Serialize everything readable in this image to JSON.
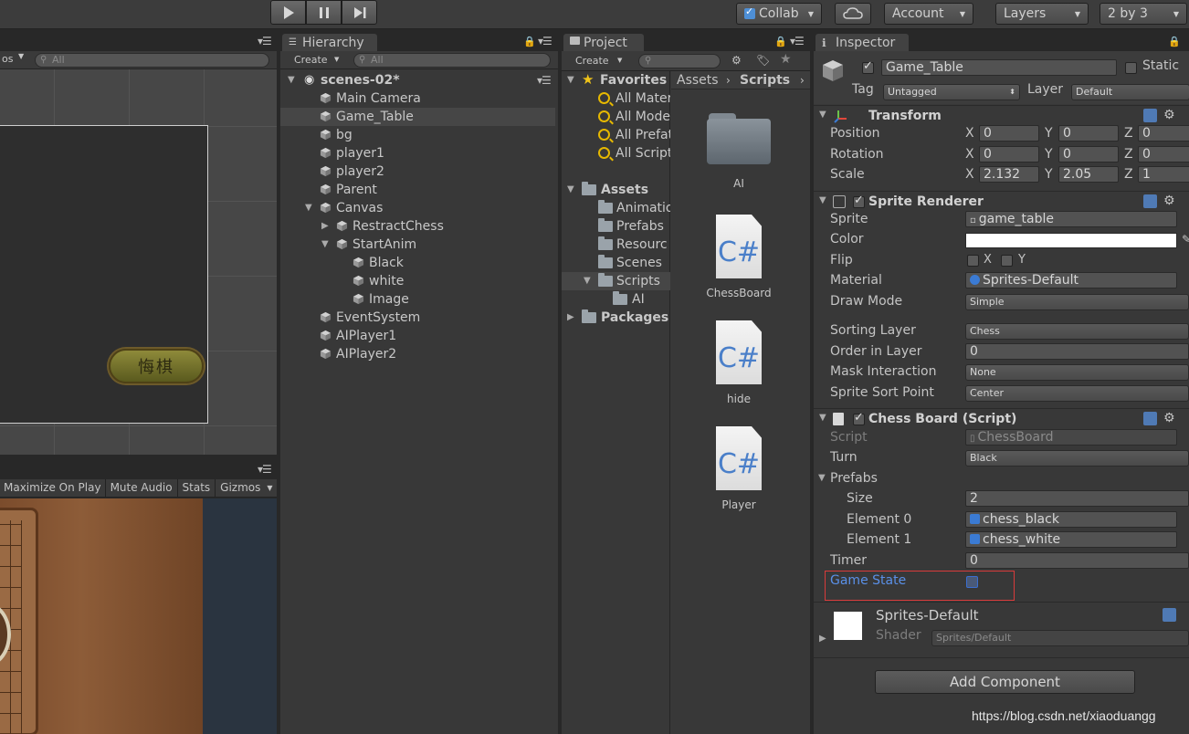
{
  "toolbar": {
    "collab": "Collab",
    "account": "Account",
    "layers": "Layers",
    "layout": "2 by 3"
  },
  "scene": {
    "gizmos_partial": "os",
    "search_placeholder": "All",
    "button_text": "悔棋"
  },
  "game_toolbar": {
    "maximize": "Maximize On Play",
    "mute": "Mute Audio",
    "stats": "Stats",
    "gizmos": "Gizmos"
  },
  "hierarchy": {
    "tab": "Hierarchy",
    "create": "Create",
    "search_placeholder": "All",
    "scene_name": "scenes-02*",
    "items": [
      {
        "label": "Main Camera"
      },
      {
        "label": "Game_Table"
      },
      {
        "label": "bg"
      },
      {
        "label": "player1"
      },
      {
        "label": "player2"
      },
      {
        "label": "Parent"
      },
      {
        "label": "Canvas"
      },
      {
        "label": "RestractChess"
      },
      {
        "label": "StartAnim"
      },
      {
        "label": "Black"
      },
      {
        "label": "white"
      },
      {
        "label": "Image"
      },
      {
        "label": "EventSystem"
      },
      {
        "label": "AIPlayer1"
      },
      {
        "label": "AIPlayer2"
      }
    ]
  },
  "project": {
    "tab": "Project",
    "create": "Create",
    "favorites": "Favorites",
    "fav_items": [
      "All Mater",
      "All Mode",
      "All Prefat",
      "All Script"
    ],
    "assets": "Assets",
    "asset_folders": [
      "Animatio",
      "Prefabs",
      "Resourc",
      "Scenes",
      "Scripts",
      "AI"
    ],
    "packages": "Packages",
    "breadcrumb": [
      "Assets",
      "Scripts"
    ],
    "files": [
      {
        "name": "AI",
        "kind": "folder"
      },
      {
        "name": "ChessBoard",
        "kind": "cs",
        "glyph": "C#"
      },
      {
        "name": "hide",
        "kind": "cs",
        "glyph": "C#"
      },
      {
        "name": "Player",
        "kind": "cs",
        "glyph": "C#"
      }
    ]
  },
  "inspector": {
    "tab": "Inspector",
    "object_name": "Game_Table",
    "static": "Static",
    "tag_label": "Tag",
    "tag_value": "Untagged",
    "layer_label": "Layer",
    "layer_value": "Default",
    "transform": {
      "title": "Transform",
      "position_label": "Position",
      "rotation_label": "Rotation",
      "scale_label": "Scale",
      "axis_x": "X",
      "axis_y": "Y",
      "axis_z": "Z",
      "position": [
        "0",
        "0",
        "0"
      ],
      "rotation": [
        "0",
        "0",
        "0"
      ],
      "scale": [
        "2.132",
        "2.05",
        "1"
      ]
    },
    "sprite_renderer": {
      "title": "Sprite Renderer",
      "sprite_label": "Sprite",
      "sprite_value": "game_table",
      "color_label": "Color",
      "color_value": "#ffffff",
      "flip_label": "Flip",
      "flip_x": "X",
      "flip_y": "Y",
      "material_label": "Material",
      "material_value": "Sprites-Default",
      "draw_mode_label": "Draw Mode",
      "draw_mode_value": "Simple",
      "sorting_layer_label": "Sorting Layer",
      "sorting_layer_value": "Chess",
      "order_label": "Order in Layer",
      "order_value": "0",
      "mask_label": "Mask Interaction",
      "mask_value": "None",
      "sort_point_label": "Sprite Sort Point",
      "sort_point_value": "Center"
    },
    "chess_board": {
      "title": "Chess Board (Script)",
      "script_label": "Script",
      "script_value": "ChessBoard",
      "turn_label": "Turn",
      "turn_value": "Black",
      "prefabs_label": "Prefabs",
      "size_label": "Size",
      "size_value": "2",
      "element0_label": "Element 0",
      "element0_value": "chess_black",
      "element1_label": "Element 1",
      "element1_value": "chess_white",
      "timer_label": "Timer",
      "timer_value": "0",
      "game_state_label": "Game State"
    },
    "material": {
      "name": "Sprites-Default",
      "shader_label": "Shader",
      "shader_value": "Sprites/Default"
    },
    "add_component": "Add Component"
  },
  "watermark": "https://blog.csdn.net/xiaoduangg"
}
